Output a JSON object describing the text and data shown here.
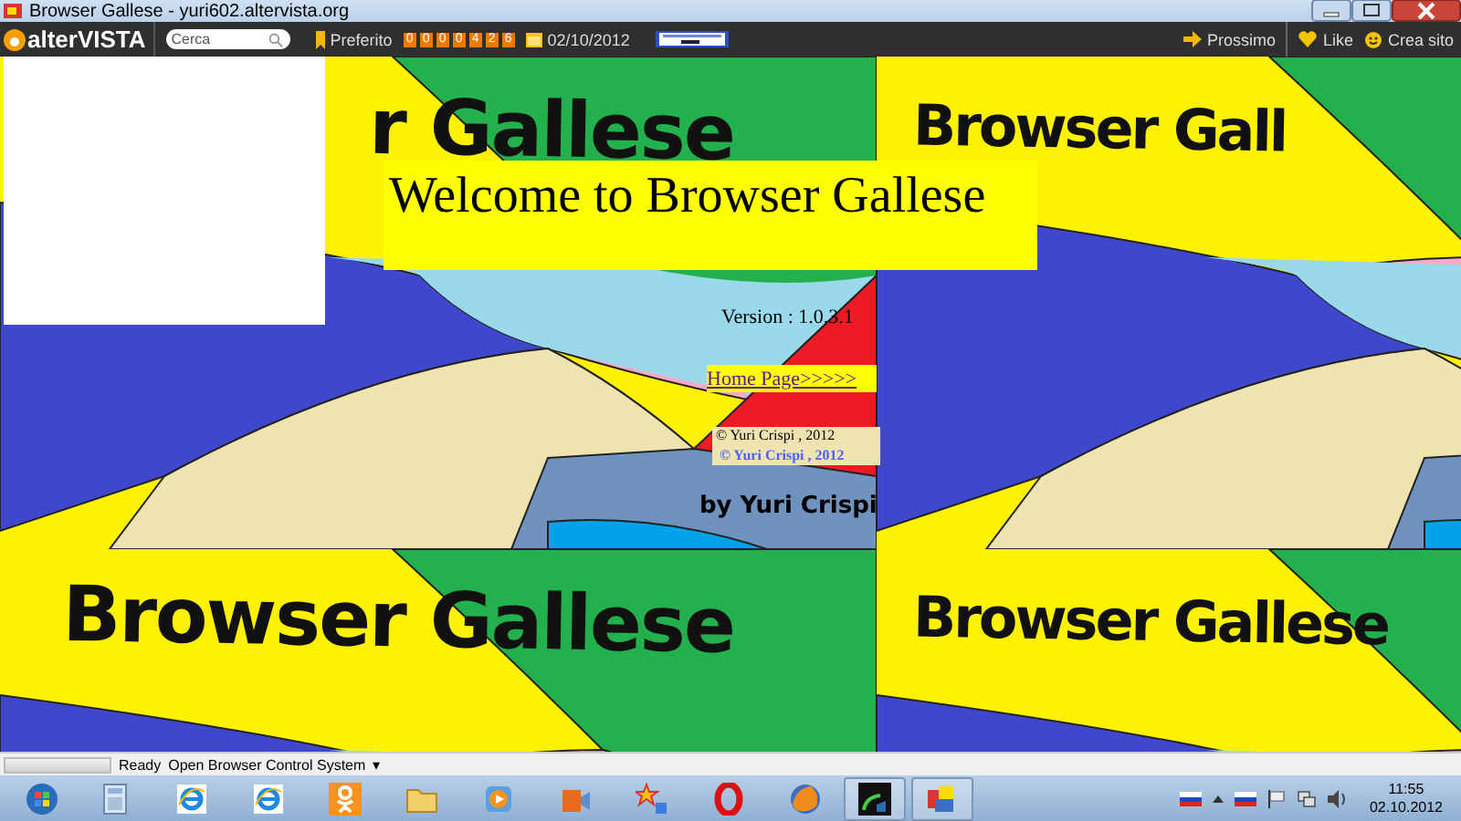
{
  "window": {
    "title": "Browser Gallese - yuri602.altervista.org"
  },
  "toolbar": {
    "logo": "alterVISTA",
    "search": {
      "placeholder": "Cerca"
    },
    "bookmark": "Preferito",
    "counter": [
      "0",
      "0",
      "0",
      "0",
      "4",
      "2",
      "6"
    ],
    "date": "02/10/2012",
    "links": [
      {
        "label": "Prossimo",
        "kind": "arrow"
      },
      {
        "label": "Like",
        "kind": "heart"
      },
      {
        "label": "Crea sito",
        "kind": "smiley"
      }
    ]
  },
  "page": {
    "tiles": [
      {
        "caption": "r Gallese"
      },
      {
        "caption": "Browser Gall"
      },
      {
        "caption": "Browser Gallese"
      },
      {
        "caption": "Browser Gallese"
      }
    ],
    "heading": "Welcome to Browser Gallese",
    "version": "Version : 1.0.3.1",
    "home_link": "Home Page>>>>>",
    "copyright": "© Yuri Crispi , 2012",
    "copyright_shadow": "© Yuri Crispi , 2012",
    "byline": "by Yuri Crispi"
  },
  "status_bar": {
    "progress": {
      "level": 0
    },
    "status": "Ready",
    "menu": "Open Browser Control System",
    "caret": "▾"
  },
  "taskbar": {
    "clock": {
      "time": "11:55",
      "date": "02.10.2012"
    }
  }
}
